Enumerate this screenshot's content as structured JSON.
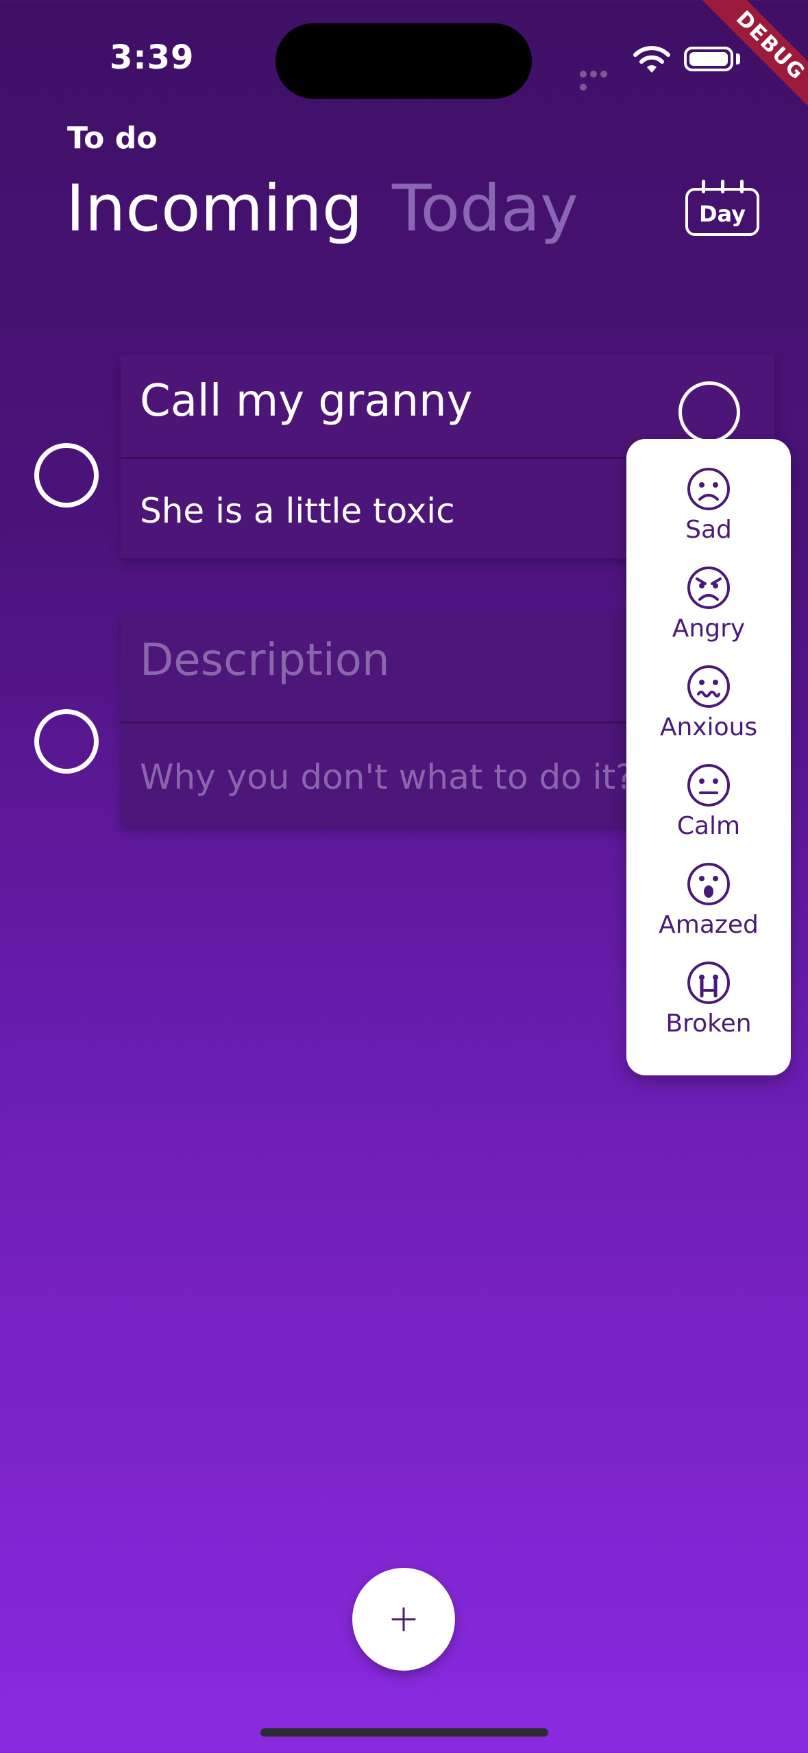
{
  "status_bar": {
    "time": "3:39"
  },
  "debug_banner": "DEBUG",
  "header": {
    "section_label": "To do",
    "tabs": [
      {
        "label": "Incoming",
        "active": true
      },
      {
        "label": "Today",
        "active": false
      }
    ],
    "day_button_label": "Day"
  },
  "tasks": [
    {
      "title": "Call my granny",
      "description": "She is a little toxic"
    },
    {
      "title_placeholder": "Description",
      "description_placeholder": "Why you don't what to do it?"
    }
  ],
  "mood_menu": {
    "items": [
      {
        "label": "Sad",
        "icon": "sad-face-icon"
      },
      {
        "label": "Angry",
        "icon": "angry-face-icon"
      },
      {
        "label": "Anxious",
        "icon": "anxious-face-icon"
      },
      {
        "label": "Calm",
        "icon": "calm-face-icon"
      },
      {
        "label": "Amazed",
        "icon": "amazed-face-icon"
      },
      {
        "label": "Broken",
        "icon": "broken-face-icon"
      }
    ]
  },
  "colors": {
    "accent_purple": "#4a1a78",
    "background_top": "#3f1066",
    "background_bottom": "#8a2ae0"
  }
}
